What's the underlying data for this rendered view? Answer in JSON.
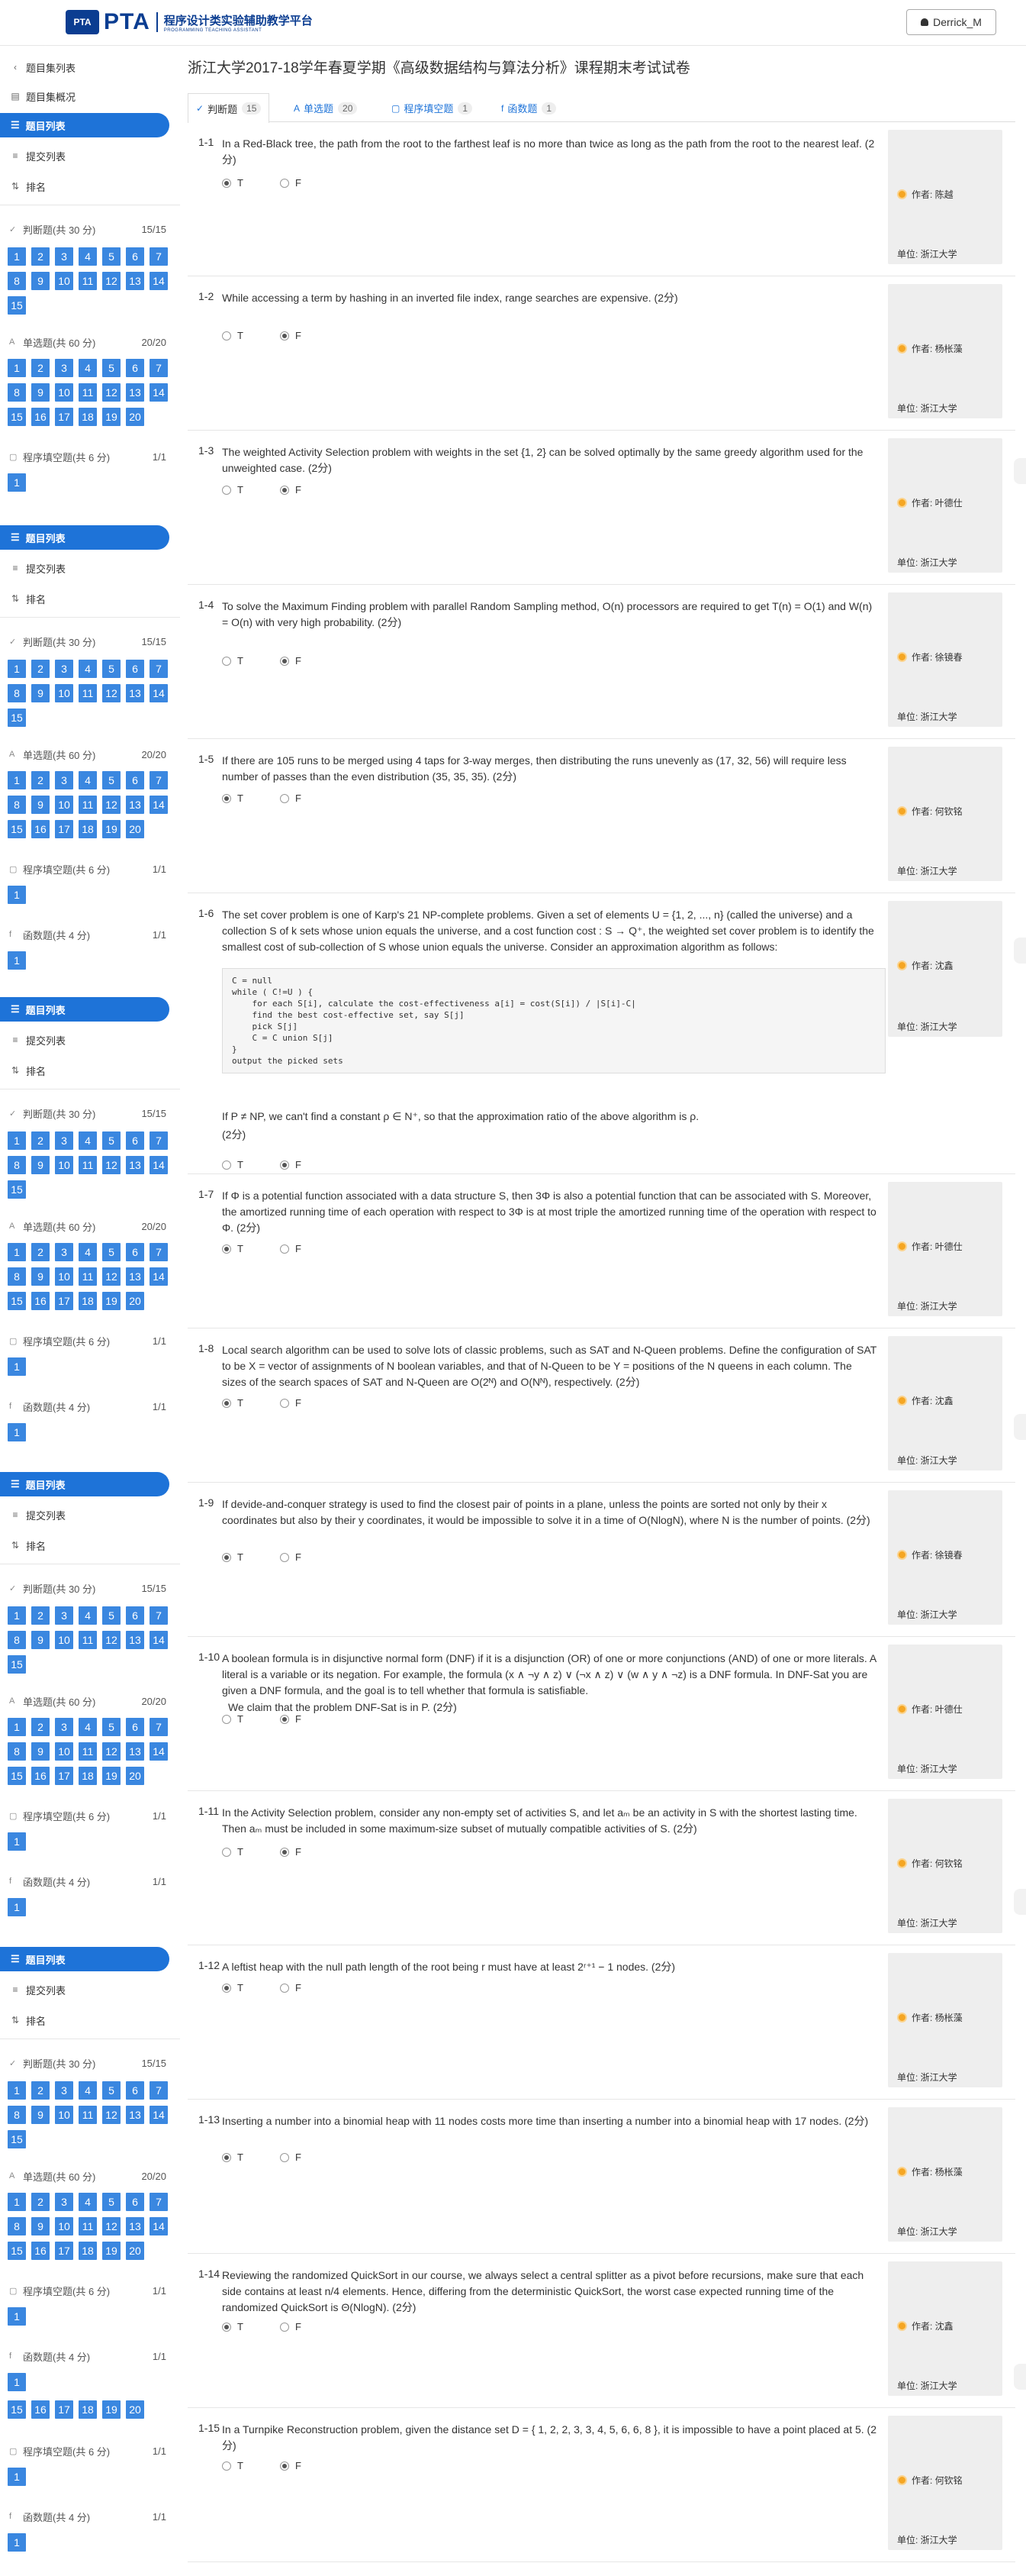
{
  "header": {
    "logo_badge": "PTA",
    "logo_text": "PTA",
    "logo_cn": "程序设计类实验辅助教学平台",
    "logo_sub": "PROGRAMMING TEACHING ASSISTANT",
    "user_name": "Derrick_M"
  },
  "sidebar": {
    "back": "题目集列表",
    "overview": "题目集概况",
    "problem_list": "题目列表",
    "submissions": "提交列表",
    "ranking": "排名",
    "sections": [
      {
        "label": "判断题(共 30 分)",
        "count": "15/15",
        "n": 15
      },
      {
        "label": "单选题(共 60 分)",
        "count": "20/20",
        "n": 20
      },
      {
        "label": "程序填空题(共 6 分)",
        "count": "1/1",
        "n": 1
      },
      {
        "label": "函数题(共 4 分)",
        "count": "1/1",
        "n": 1
      }
    ]
  },
  "exam": {
    "title": "浙江大学2017-18学年春夏学期《高级数据结构与算法分析》课程期末考试试卷",
    "tabs": [
      {
        "label": "判断题",
        "count": "15"
      },
      {
        "label": "单选题",
        "count": "20"
      },
      {
        "label": "程序填空题",
        "count": "1"
      },
      {
        "label": "函数题",
        "count": "1"
      }
    ]
  },
  "options": {
    "t": "T",
    "f": "F"
  },
  "unit_label": "单位: 浙江大学",
  "questions": [
    {
      "id": "1-1",
      "text": "In a Red-Black tree, the path from the root to the farthest leaf is no more than twice as long as the path from the root to the nearest leaf. (2分)",
      "selected": "T",
      "author": "作者: 陈越"
    },
    {
      "id": "1-2",
      "text": "While accessing a term by hashing in an inverted file index, range searches are expensive. (2分)",
      "selected": "F",
      "author": "作者: 杨枨藻"
    },
    {
      "id": "1-3",
      "text": "The weighted Activity Selection problem with weights in the set {1, 2} can be solved optimally by the same greedy algorithm used for the unweighted case. (2分)",
      "selected": "F",
      "author": "作者: 叶德仕"
    },
    {
      "id": "1-4",
      "text": "To solve the Maximum Finding problem with parallel Random Sampling method, O(n) processors are required to get T(n) = O(1) and W(n) = O(n) with very high probability. (2分)",
      "selected": "F",
      "author": "作者: 徐镜春"
    },
    {
      "id": "1-5",
      "text": "If there are 105 runs to be merged using 4 taps for 3-way merges, then distributing the runs unevenly as (17, 32, 56) will require less number of passes than the even distribution (35, 35, 35). (2分)",
      "selected": "T",
      "author": "作者: 何钦铭"
    },
    {
      "id": "1-6",
      "text": "The set cover problem is one of Karp's 21 NP-complete problems. Given a set of elements U = {1, 2, ..., n} (called the universe) and a collection S of k sets whose union equals the universe, and a cost function cost : S → Q⁺, the weighted set cover problem is to identify the smallest cost of sub-collection of S whose union equals the universe. Consider an approximation algorithm as follows:",
      "code": "C = null\nwhile ( C!=U ) {\n    for each S[i], calculate the cost-effectiveness a[i] = cost(S[i]) / |S[i]-C|\n    find the best cost-effective set, say S[j]\n    pick S[j]\n    C = C union S[j]\n}\noutput the picked sets",
      "extra": "If P ≠ NP, we can't find a constant ρ ∈ N⁺, so that the approximation ratio of the above algorithm is ρ.",
      "points": "(2分)",
      "selected": "F",
      "author": "作者: 沈鑫"
    },
    {
      "id": "1-7",
      "text": "If Φ is a potential function associated with a data structure S, then 3Φ is also a potential function that can be associated with S. Moreover, the amortized running time of each operation with respect to 3Φ is at most triple the amortized running time of the operation with respect to Φ. (2分)",
      "selected": "T",
      "author": "作者: 叶德仕"
    },
    {
      "id": "1-8",
      "text": "Local search algorithm can be used to solve lots of classic problems, such as SAT and N-Queen problems. Define the configuration of SAT to be X = vector of assignments of N boolean variables, and that of N-Queen to be Y = positions of the N queens in each column. The sizes of the search spaces of SAT and N-Queen are O(2ᴺ) and O(Nᴺ), respectively. (2分)",
      "selected": "T",
      "author": "作者: 沈鑫"
    },
    {
      "id": "1-9",
      "text": "If devide-and-conquer strategy is used to find the closest pair of points in a plane, unless the points are sorted not only by their x coordinates but also by their y coordinates, it would be impossible to solve it in a time of O(NlogN), where N is the number of points. (2分)",
      "selected": "T",
      "author": "作者: 徐镜春"
    },
    {
      "id": "1-10",
      "text": "A boolean formula is in disjunctive normal form (DNF) if it is a disjunction (OR) of one or more conjunctions (AND) of one or more literals. A literal is a variable or its negation. For example, the formula (x ∧ ¬y ∧ z) ∨ (¬x ∧ z) ∨ (w ∧ y ∧ ¬z) is a DNF formula. In DNF-Sat you are given a DNF formula, and the goal is to tell whether that formula is satisfiable.",
      "extra": "We claim that the problem DNF-Sat is in P. (2分)",
      "selected": "F",
      "author": "作者: 叶德仕"
    },
    {
      "id": "1-11",
      "text": "In the Activity Selection problem, consider any non-empty set of activities S, and let aₘ be an activity in S with the shortest lasting time. Then aₘ must be included in some maximum-size subset of mutually compatible activities of S. (2分)",
      "selected": "F",
      "author": "作者: 何钦铭"
    },
    {
      "id": "1-12",
      "text": "A leftist heap with the null path length of the root being r must have at least 2ʳ⁺¹ − 1 nodes. (2分)",
      "selected": "T",
      "author": "作者: 杨枨藻"
    },
    {
      "id": "1-13",
      "text": "Inserting a number into a binomial heap with 11 nodes costs more time than inserting a number into a binomial heap with 17 nodes. (2分)",
      "selected": "T",
      "author": "作者: 杨枨藻"
    },
    {
      "id": "1-14",
      "text": "Reviewing the randomized QuickSort in our course, we always select a central splitter as a pivot before recursions, make sure that each side contains at least n/4 elements. Hence, differing from the deterministic QuickSort, the worst case expected running time of the randomized QuickSort is Θ(NlogN). (2分)",
      "selected": "T",
      "author": "作者: 沈鑫"
    },
    {
      "id": "1-15",
      "text": "In a Turnpike Reconstruction problem, given the distance set D = { 1, 2, 2, 3, 3, 4, 5, 6, 6, 8 }, it is impossible to have a point placed at 5. (2分)",
      "selected": "F",
      "author": "作者: 何钦铭"
    }
  ]
}
